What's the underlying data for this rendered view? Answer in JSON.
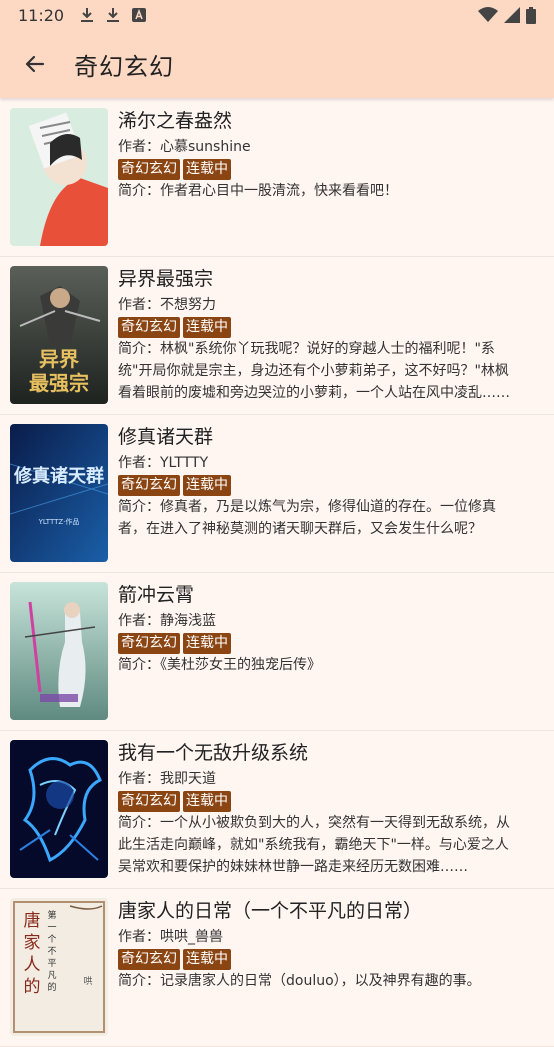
{
  "status": {
    "time": "11:20"
  },
  "header": {
    "title": "奇幻玄幻"
  },
  "books": [
    {
      "title": "浠尔之春盎然",
      "author": "作者：心慕sunshine",
      "tags": [
        "奇幻玄幻",
        "连载中"
      ],
      "desc": "简介：作者君心目中一股清流，快来看看吧！"
    },
    {
      "title": "异界最强宗",
      "author": "作者：不想努力",
      "tags": [
        "奇幻玄幻",
        "连载中"
      ],
      "desc": "简介：林枫\"系统你丫玩我呢？说好的穿越人士的福利呢！\"系统\"开局你就是宗主，身边还有个小萝莉弟子，这不好吗？\"林枫看着眼前的废墟和旁边哭泣的小萝莉，一个人站在风中凌乱……"
    },
    {
      "title": "修真诸天群",
      "author": "作者：YLTTTY",
      "tags": [
        "奇幻玄幻",
        "连载中"
      ],
      "desc": "简介：修真者，乃是以炼气为宗，修得仙道的存在。一位修真者，在进入了神秘莫测的诸天聊天群后，又会发生什么呢？"
    },
    {
      "title": "箭冲云霄",
      "author": "作者：静海浅蓝",
      "tags": [
        "奇幻玄幻",
        "连载中"
      ],
      "desc": "简介：《美杜莎女王的独宠后传》"
    },
    {
      "title": "我有一个无敌升级系统",
      "author": "作者：我即天道",
      "tags": [
        "奇幻玄幻",
        "连载中"
      ],
      "desc": "简介：一个从小被欺负到大的人，突然有一天得到无敌系统，从此生活走向巅峰，就如\"系统我有，霸绝天下\"一样。与心爱之人吴常欢和要保护的妹妹林世静一路走来经历无数困难……"
    },
    {
      "title": "唐家人的日常（一个不平凡的日常）",
      "author": "作者：哄哄_兽兽",
      "tags": [
        "奇幻玄幻",
        "连载中"
      ],
      "desc": "简介：记录唐家人的日常（douluo），以及神界有趣的事。"
    }
  ]
}
